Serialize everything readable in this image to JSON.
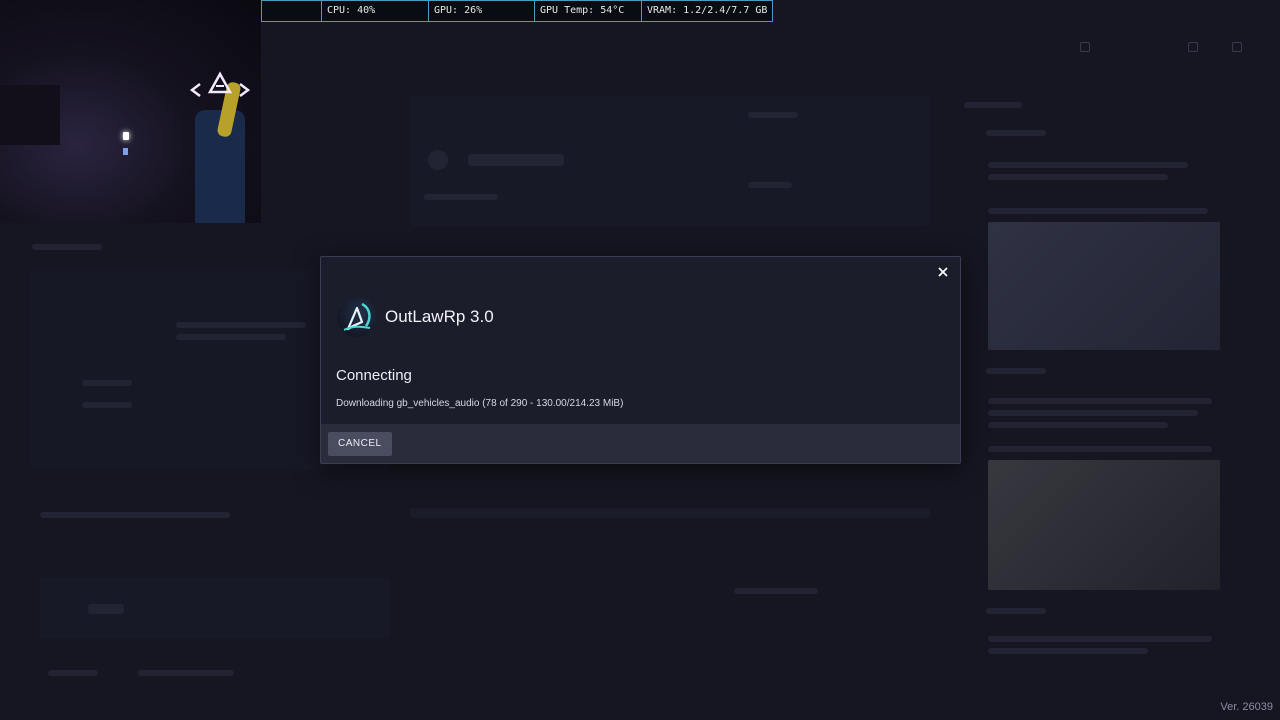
{
  "stats": {
    "blank": "",
    "cpu": "CPU: 40%",
    "gpu": "GPU: 26%",
    "gpu_temp": "GPU Temp: 54°C",
    "vram": "VRAM: 1.2/2.4/7.7 GB"
  },
  "modal": {
    "server_name": "OutLawRp 3.0",
    "status_title": "Connecting",
    "status_detail": "Downloading gb_vehicles_audio (78 of 290 - 130.00/214.23 MiB)",
    "cancel_label": "CANCEL"
  },
  "version": "Ver. 26039",
  "icons": {
    "close": "close-icon",
    "server_logo": "server-logo-icon"
  },
  "colors": {
    "stats_border": "#4a9bc4",
    "modal_bg": "#1b1d2b",
    "footer_bg": "#2a2c3b",
    "button_bg": "#4a4d5f"
  }
}
